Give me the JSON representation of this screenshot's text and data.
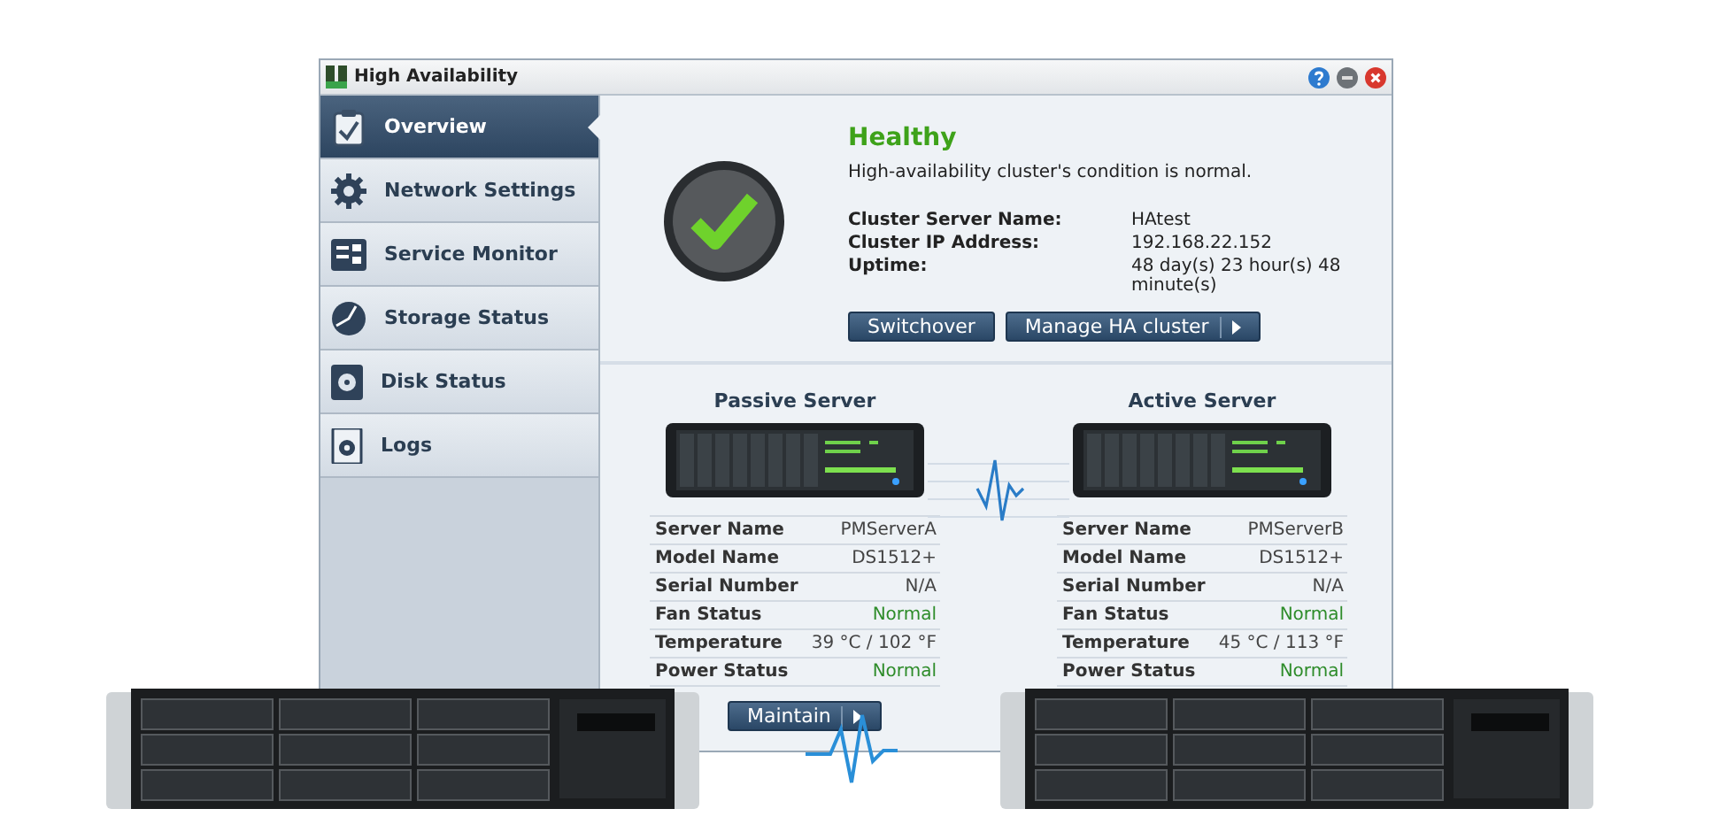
{
  "window": {
    "title": "High Availability"
  },
  "sidebar": {
    "items": [
      {
        "label": "Overview",
        "selected": true,
        "kind": "overview"
      },
      {
        "label": "Network Settings",
        "selected": false,
        "kind": "network"
      },
      {
        "label": "Service Monitor",
        "selected": false,
        "kind": "service"
      },
      {
        "label": "Storage Status",
        "selected": false,
        "kind": "storage"
      },
      {
        "label": "Disk Status",
        "selected": false,
        "kind": "disk"
      },
      {
        "label": "Logs",
        "selected": false,
        "kind": "logs"
      }
    ]
  },
  "summary": {
    "status": "Healthy",
    "message": "High-availability cluster's condition is normal.",
    "fields": [
      {
        "label": "Cluster Server Name:",
        "value": "HAtest"
      },
      {
        "label": "Cluster IP Address:",
        "value": "192.168.22.152"
      },
      {
        "label": "Uptime:",
        "value": "48 day(s) 23 hour(s) 48 minute(s)"
      }
    ],
    "buttons": [
      {
        "label": "Switchover",
        "kind": "plain"
      },
      {
        "label": "Manage HA cluster",
        "kind": "menu"
      }
    ]
  },
  "servers": [
    {
      "title": "Passive Server",
      "rows": [
        {
          "label": "Server Name",
          "value": "PMServerA",
          "kind": "text"
        },
        {
          "label": "Model Name",
          "value": "DS1512+",
          "kind": "text"
        },
        {
          "label": "Serial Number",
          "value": "N/A",
          "kind": "text"
        },
        {
          "label": "Fan Status",
          "value": "Normal",
          "kind": "status"
        },
        {
          "label": "Temperature",
          "value": "39 °C / 102 °F",
          "kind": "text"
        },
        {
          "label": "Power Status",
          "value": "Normal",
          "kind": "status"
        }
      ]
    },
    {
      "title": "Active Server",
      "rows": [
        {
          "label": "Server Name",
          "value": "PMServerB",
          "kind": "text"
        },
        {
          "label": "Model Name",
          "value": "DS1512+",
          "kind": "text"
        },
        {
          "label": "Serial Number",
          "value": "N/A",
          "kind": "text"
        },
        {
          "label": "Fan Status",
          "value": "Normal",
          "kind": "status"
        },
        {
          "label": "Temperature",
          "value": "45 °C / 113 °F",
          "kind": "text"
        },
        {
          "label": "Power Status",
          "value": "Normal",
          "kind": "status"
        }
      ]
    }
  ],
  "maintain_button": {
    "label": "Maintain",
    "kind": "menu"
  }
}
